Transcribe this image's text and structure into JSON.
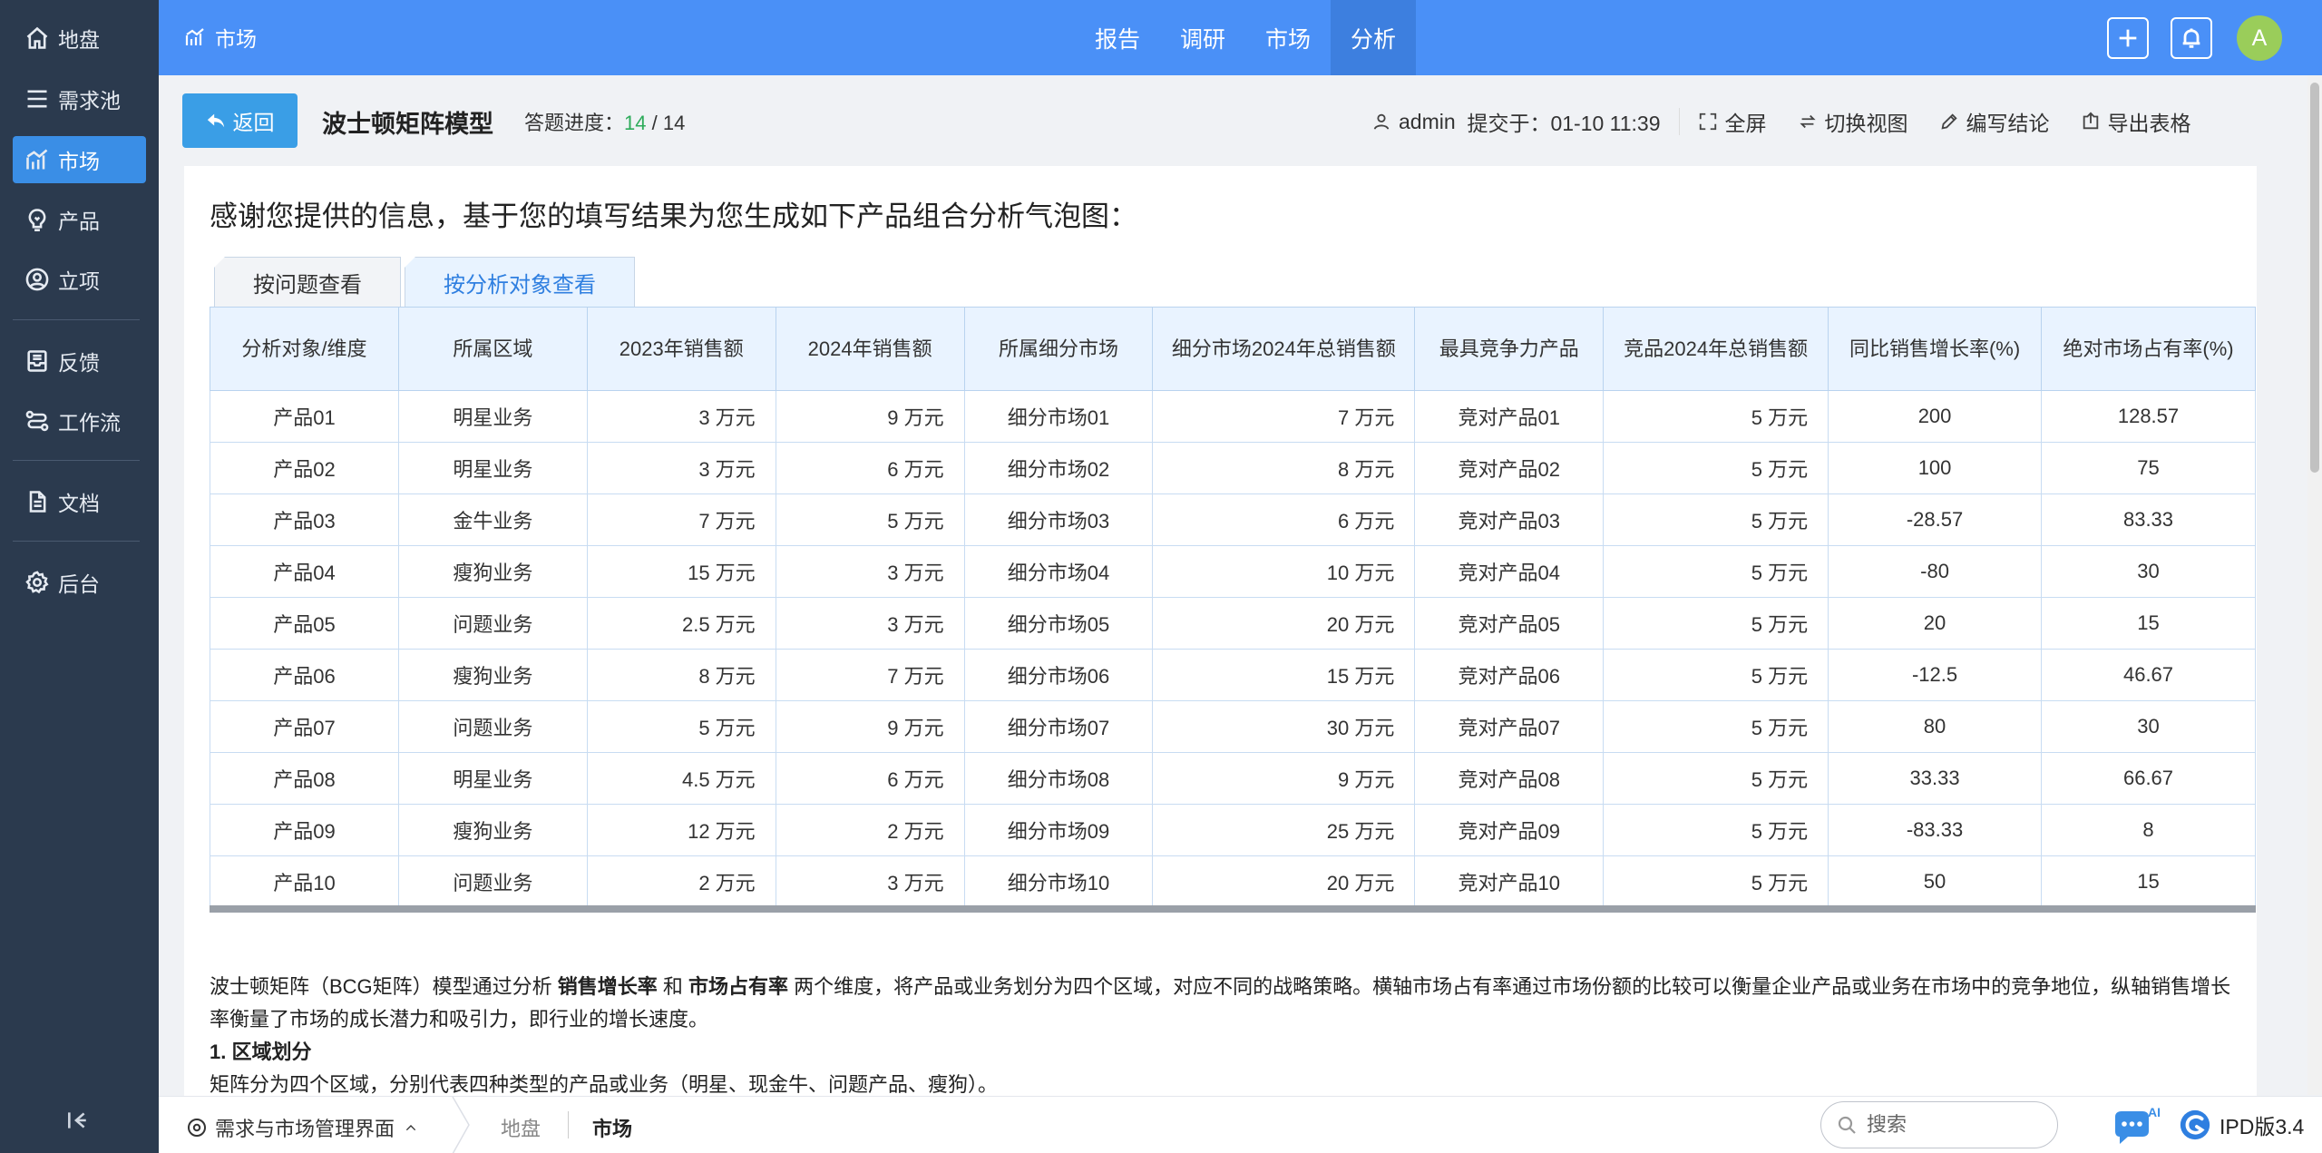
{
  "sidebar": {
    "items": [
      {
        "label": "地盘",
        "icon": "home-icon"
      },
      {
        "label": "需求池",
        "icon": "menu-icon"
      },
      {
        "label": "市场",
        "icon": "chart-icon",
        "active": true
      },
      {
        "label": "产品",
        "icon": "bulb-icon"
      },
      {
        "label": "立项",
        "icon": "user-circle-icon"
      },
      {
        "label": "反馈",
        "icon": "inbox-icon"
      },
      {
        "label": "工作流",
        "icon": "workflow-icon"
      },
      {
        "label": "文档",
        "icon": "document-icon"
      },
      {
        "label": "后台",
        "icon": "gear-icon"
      }
    ]
  },
  "topbar": {
    "title": "市场",
    "nav": [
      "报告",
      "调研",
      "市场",
      "分析"
    ],
    "active_nav": "分析",
    "avatar": "A"
  },
  "header": {
    "back_label": "返回",
    "title": "波士顿矩阵模型",
    "progress_label": "答题进度：",
    "progress_done": "14",
    "progress_sep": " / ",
    "progress_total": "14",
    "user": "admin",
    "submitted": "提交于：01-10 11:39",
    "actions": [
      "全屏",
      "切换视图",
      "编写结论",
      "导出表格"
    ]
  },
  "content": {
    "intro": "感谢您提供的信息，基于您的填写结果为您生成如下产品组合分析气泡图：",
    "tabs": [
      "按问题查看",
      "按分析对象查看"
    ],
    "active_tab": "按分析对象查看",
    "columns": [
      "分析对象/维度",
      "所属区域",
      "2023年销售额",
      "2024年销售额",
      "所属细分市场",
      "细分市场2024年总销售额",
      "最具竞争力产品",
      "竞品2024年总销售额",
      "同比销售增长率(%)",
      "绝对市场占有率(%)"
    ],
    "rows": [
      [
        "产品01",
        "明星业务",
        "3 万元",
        "9 万元",
        "细分市场01",
        "7 万元",
        "竞对产品01",
        "5 万元",
        "200",
        "128.57"
      ],
      [
        "产品02",
        "明星业务",
        "3 万元",
        "6 万元",
        "细分市场02",
        "8 万元",
        "竞对产品02",
        "5 万元",
        "100",
        "75"
      ],
      [
        "产品03",
        "金牛业务",
        "7 万元",
        "5 万元",
        "细分市场03",
        "6 万元",
        "竞对产品03",
        "5 万元",
        "-28.57",
        "83.33"
      ],
      [
        "产品04",
        "瘦狗业务",
        "15 万元",
        "3 万元",
        "细分市场04",
        "10 万元",
        "竞对产品04",
        "5 万元",
        "-80",
        "30"
      ],
      [
        "产品05",
        "问题业务",
        "2.5 万元",
        "3 万元",
        "细分市场05",
        "20 万元",
        "竞对产品05",
        "5 万元",
        "20",
        "15"
      ],
      [
        "产品06",
        "瘦狗业务",
        "8 万元",
        "7 万元",
        "细分市场06",
        "15 万元",
        "竞对产品06",
        "5 万元",
        "-12.5",
        "46.67"
      ],
      [
        "产品07",
        "问题业务",
        "5 万元",
        "9 万元",
        "细分市场07",
        "30 万元",
        "竞对产品07",
        "5 万元",
        "80",
        "30"
      ],
      [
        "产品08",
        "明星业务",
        "4.5 万元",
        "6 万元",
        "细分市场08",
        "9 万元",
        "竞对产品08",
        "5 万元",
        "33.33",
        "66.67"
      ],
      [
        "产品09",
        "瘦狗业务",
        "12 万元",
        "2 万元",
        "细分市场09",
        "25 万元",
        "竞对产品09",
        "5 万元",
        "-83.33",
        "8"
      ],
      [
        "产品10",
        "问题业务",
        "2 万元",
        "3 万元",
        "细分市场10",
        "20 万元",
        "竞对产品10",
        "5 万元",
        "50",
        "15"
      ]
    ],
    "desc_part1": "波士顿矩阵（BCG矩阵）模型通过分析 ",
    "desc_bold1": "销售增长率",
    "desc_part2": " 和 ",
    "desc_bold2": "市场占有率",
    "desc_part3": " 两个维度，将产品或业务划分为四个区域，对应不同的战略策略。横轴市场占有率通过市场份额的比较可以衡量企业产品或业务在市场中的竞争地位，纵轴销售增长率衡量了市场的成长潜力和吸引力，即行业的增长速度。",
    "section_title": "1. 区域划分",
    "section_text": "矩阵分为四个区域，分别代表四种类型的产品或业务（明星、现金牛、问题产品、瘦狗）。"
  },
  "bottombar": {
    "root": "需求与市场管理界面",
    "crumb1": "地盘",
    "crumb2": "市场",
    "search_placeholder": "搜索",
    "version": "IPD版3.4"
  }
}
